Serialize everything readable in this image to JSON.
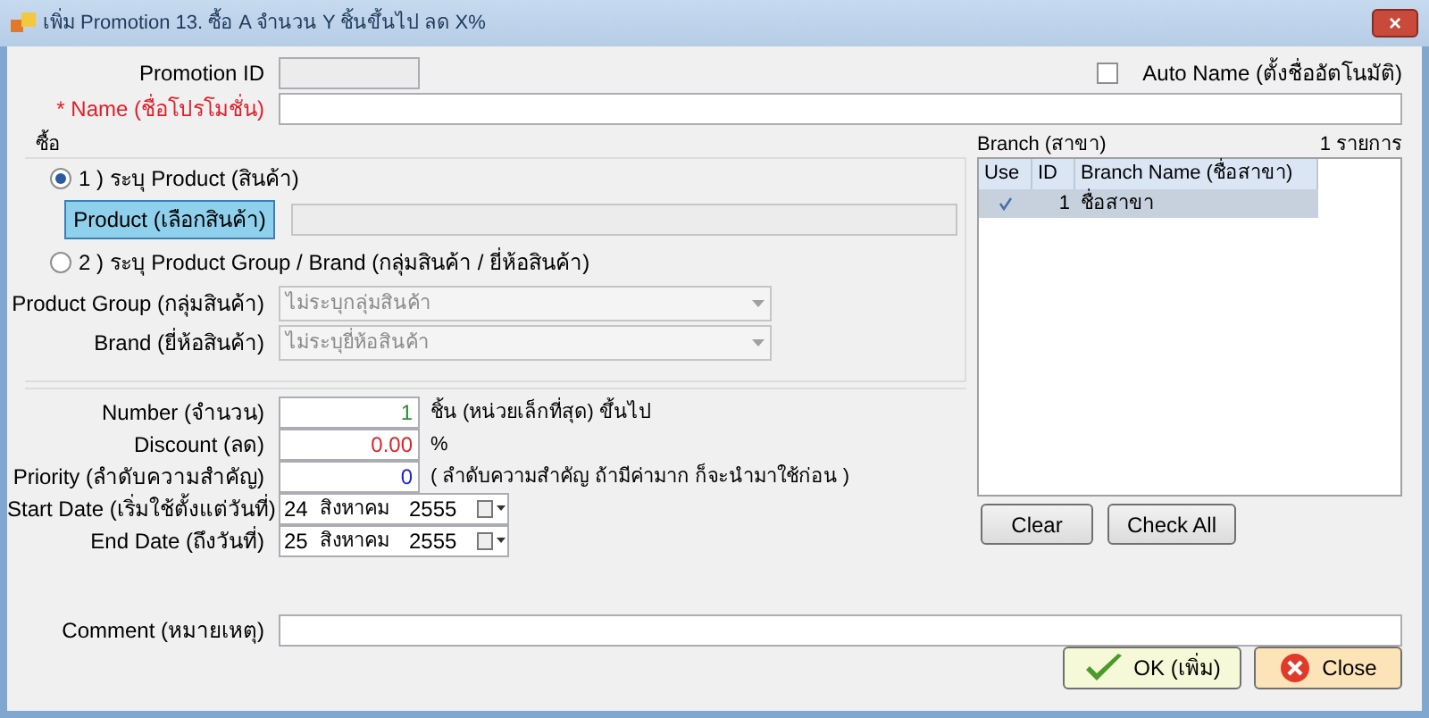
{
  "window": {
    "title": "เพิ่ม Promotion 13. ซื้อ A จำนวน Y ชิ้นขึ้นไป ลด X%",
    "close": "×"
  },
  "promotion_id": {
    "label": "Promotion ID"
  },
  "auto_name": {
    "label": "Auto Name (ตั้งชื่ออัตโนมัติ)",
    "checked": false
  },
  "name": {
    "label": "* Name (ชื่อโปรโมชั่น)"
  },
  "buy_group": {
    "title": "ซื้อ",
    "options": [
      {
        "label": "1 ) ระบุ Product (สินค้า)",
        "selected": true
      },
      {
        "label": "2 ) ระบุ Product Group / Brand (กลุ่มสินค้า / ยี่ห้อสินค้า)",
        "selected": false
      }
    ],
    "product_button": "Product (เลือกสินค้า)",
    "product_group": {
      "label": "Product Group (กลุ่มสินค้า)",
      "value": "ไม่ระบุกลุ่มสินค้า"
    },
    "brand": {
      "label": "Brand (ยี่ห้อสินค้า)",
      "value": "ไม่ระบุยี่ห้อสินค้า"
    }
  },
  "number": {
    "label": "Number (จำนวน)",
    "value": "1",
    "suffix": "ชิ้น (หน่วยเล็กที่สุด) ขึ้นไป"
  },
  "discount": {
    "label": "Discount (ลด)",
    "value": "0.00",
    "suffix": "%"
  },
  "priority": {
    "label": "Priority (ลำดับความสำคัญ)",
    "value": "0",
    "suffix": "( ลำดับความสำคัญ ถ้ามีค่ามาก ก็จะนำมาใช้ก่อน )"
  },
  "start_date": {
    "label": "Start Date (เริ่มใช้ตั้งแต่วันที่)",
    "day": "24",
    "month": "สิงหาคม",
    "year": "2555"
  },
  "end_date": {
    "label": "End Date (ถึงวันที่)",
    "day": "25",
    "month": "สิงหาคม",
    "year": "2555"
  },
  "comment": {
    "label": "Comment (หมายเหตุ)"
  },
  "branch": {
    "label": "Branch (สาขา)",
    "count": "1 รายการ",
    "columns": [
      "Use",
      "ID",
      "Branch Name (ชื่อสาขา)"
    ],
    "rows": [
      {
        "checked": true,
        "id": "1",
        "name": "ชื่อสาขา",
        "selected": true
      }
    ],
    "buttons": [
      "Clear",
      "Check All"
    ]
  },
  "buttons": {
    "ok": "OK (เพิ่ม)",
    "close": "Close"
  }
}
